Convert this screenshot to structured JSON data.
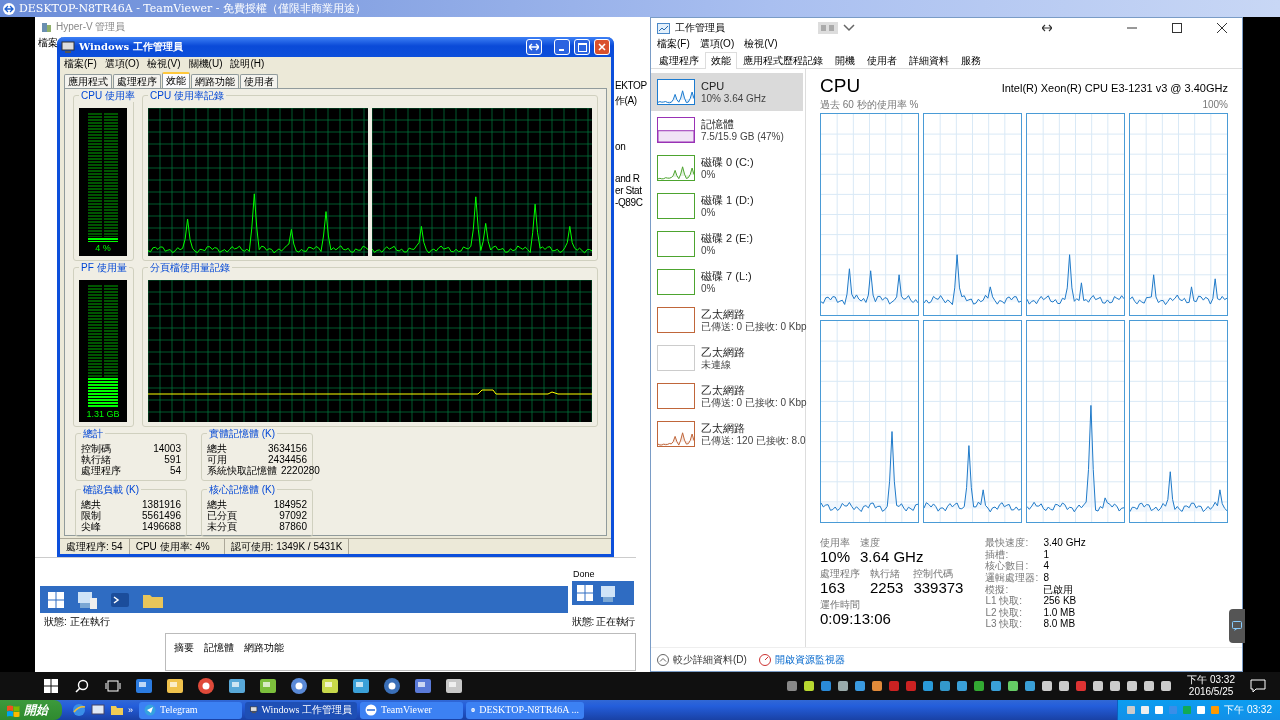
{
  "teamviewer": {
    "title": "DESKTOP-N8TR46A - TeamViewer - 免費授權（僅限非商業用途）"
  },
  "hyperv": {
    "title": "Hyper-V 管理員",
    "menu_fragment": "檔案",
    "side_fragments": [
      "EKTOP",
      "作(A)",
      "on",
      "and R",
      "er Stat",
      "-Q89C"
    ],
    "status": "狀態: 正在執行",
    "detail_tabs": [
      "摘要",
      "記憶體",
      "網路功能"
    ],
    "side_pane": {
      "caption": "Done",
      "status": "狀態: 正在執行"
    }
  },
  "xp_task_manager": {
    "title": "Windows 工作管理員",
    "menu": [
      "檔案(F)",
      "選項(O)",
      "檢視(V)",
      "關機(U)",
      "說明(H)"
    ],
    "tabs": [
      {
        "label": "應用程式",
        "selected": false
      },
      {
        "label": "處理程序",
        "selected": false
      },
      {
        "label": "效能",
        "selected": true
      },
      {
        "label": "網路功能",
        "selected": false
      },
      {
        "label": "使用者",
        "selected": false
      }
    ],
    "cpu_meter": {
      "title": "CPU 使用率",
      "level": 0.04,
      "reading": "4 %"
    },
    "cpu_history": {
      "title": "CPU 使用率記錄"
    },
    "pf_meter": {
      "title": "PF 使用量",
      "level": 0.25,
      "reading": "1.31 GB"
    },
    "pf_history": {
      "title": "分頁檔使用量記錄"
    },
    "stat_groups": [
      {
        "title": "總計",
        "rows": [
          {
            "label": "控制碼",
            "value": "14003"
          },
          {
            "label": "執行緒",
            "value": "591"
          },
          {
            "label": "處理程序",
            "value": "54"
          }
        ]
      },
      {
        "title": "實體記憶體 (K)",
        "rows": [
          {
            "label": "總共",
            "value": "3634156"
          },
          {
            "label": "可用",
            "value": "2434456"
          },
          {
            "label": "系統快取記憶體",
            "value": "2220280"
          }
        ]
      },
      {
        "title": "確認負載 (K)",
        "rows": [
          {
            "label": "總共",
            "value": "1381916"
          },
          {
            "label": "限制",
            "value": "5561496"
          },
          {
            "label": "尖峰",
            "value": "1496688"
          }
        ]
      },
      {
        "title": "核心記憶體 (K)",
        "rows": [
          {
            "label": "總共",
            "value": "184952"
          },
          {
            "label": "已分頁",
            "value": "97092"
          },
          {
            "label": "未分頁",
            "value": "87860"
          }
        ]
      }
    ],
    "status_bar": [
      "處理程序: 54",
      "CPU 使用率: 4%",
      "認可使用: 1349K / 5431K"
    ]
  },
  "task_manager": {
    "title": "工作管理員",
    "menu": [
      "檔案(F)",
      "選項(O)",
      "檢視(V)"
    ],
    "tabs": [
      {
        "label": "處理程序",
        "selected": false
      },
      {
        "label": "效能",
        "selected": true
      },
      {
        "label": "應用程式歷程記錄",
        "selected": false
      },
      {
        "label": "開機",
        "selected": false
      },
      {
        "label": "使用者",
        "selected": false
      },
      {
        "label": "詳細資料",
        "selected": false
      },
      {
        "label": "服務",
        "selected": false
      }
    ],
    "resources": [
      {
        "name": "CPU",
        "detail": "10% 3.64 GHz",
        "color": "#1b7bd0",
        "kind": "activity",
        "selected": true
      },
      {
        "name": "記憶體",
        "detail": "7.5/15.9 GB (47%)",
        "color": "#9932b5",
        "kind": "level",
        "level": 0.47,
        "selected": false
      },
      {
        "name": "磁碟 0 (C:)",
        "detail": "0%",
        "color": "#4da42f",
        "kind": "activity",
        "selected": false
      },
      {
        "name": "磁碟 1 (D:)",
        "detail": "0%",
        "color": "#4da42f",
        "kind": "idle",
        "selected": false
      },
      {
        "name": "磁碟 2 (E:)",
        "detail": "0%",
        "color": "#4da42f",
        "kind": "idle",
        "selected": false
      },
      {
        "name": "磁碟 7 (L:)",
        "detail": "0%",
        "color": "#4da42f",
        "kind": "idle",
        "selected": false
      },
      {
        "name": "乙太網路",
        "detail": "已傳送: 0 已接收: 0 Kbp",
        "color": "#c0663a",
        "kind": "idle",
        "selected": false
      },
      {
        "name": "乙太網路",
        "detail": "未連線",
        "color": "#cccccc",
        "kind": "idle",
        "selected": false
      },
      {
        "name": "乙太網路",
        "detail": "已傳送: 0 已接收: 0 Kbp",
        "color": "#c0663a",
        "kind": "idle",
        "selected": false
      },
      {
        "name": "乙太網路",
        "detail": "已傳送: 120 已接收: 8.0",
        "color": "#c0663a",
        "kind": "activity",
        "selected": false
      }
    ],
    "heading": "CPU",
    "model": "Intel(R) Xeon(R) CPU E3-1231 v3 @ 3.40GHz",
    "graph_caption": "過去 60 秒的使用率 %",
    "graph_max": "100%",
    "metric_rows": [
      [
        {
          "label": "使用率",
          "value": "10%"
        },
        {
          "label": "速度",
          "value": "3.64 GHz"
        }
      ],
      [
        {
          "label": "處理程序",
          "value": "163"
        },
        {
          "label": "執行緒",
          "value": "2253"
        },
        {
          "label": "控制代碼",
          "value": "339373"
        }
      ],
      [
        {
          "label": "運作時間",
          "value": "0:09:13:06"
        }
      ]
    ],
    "specs": [
      {
        "label": "最快速度:",
        "value": "3.40 GHz"
      },
      {
        "label": "插槽:",
        "value": "1"
      },
      {
        "label": "核心數目:",
        "value": "4"
      },
      {
        "label": "邏輯處理器:",
        "value": "8"
      },
      {
        "label": "模擬:",
        "value": "已啟用"
      },
      {
        "label": "L1 快取:",
        "value": "256 KB"
      },
      {
        "label": "L2 快取:",
        "value": "1.0 MB"
      },
      {
        "label": "L3 快取:",
        "value": "8.0 MB"
      }
    ],
    "fewer_details": "較少詳細資料(D)",
    "resource_monitor": "開啟資源監視器"
  },
  "win10_taskbar": {
    "time": "下午 03:32",
    "date": "2016/5/25"
  },
  "xp_taskbar": {
    "start": "開始",
    "chevron": "»",
    "buttons": [
      {
        "label": "Telegram",
        "selected": false
      },
      {
        "label": "Windows 工作管理員",
        "selected": true
      },
      {
        "label": "TeamViewer",
        "selected": false
      },
      {
        "label": "DESKTOP-N8TR46A ...",
        "selected": false
      }
    ],
    "time": "下午 03:32"
  }
}
